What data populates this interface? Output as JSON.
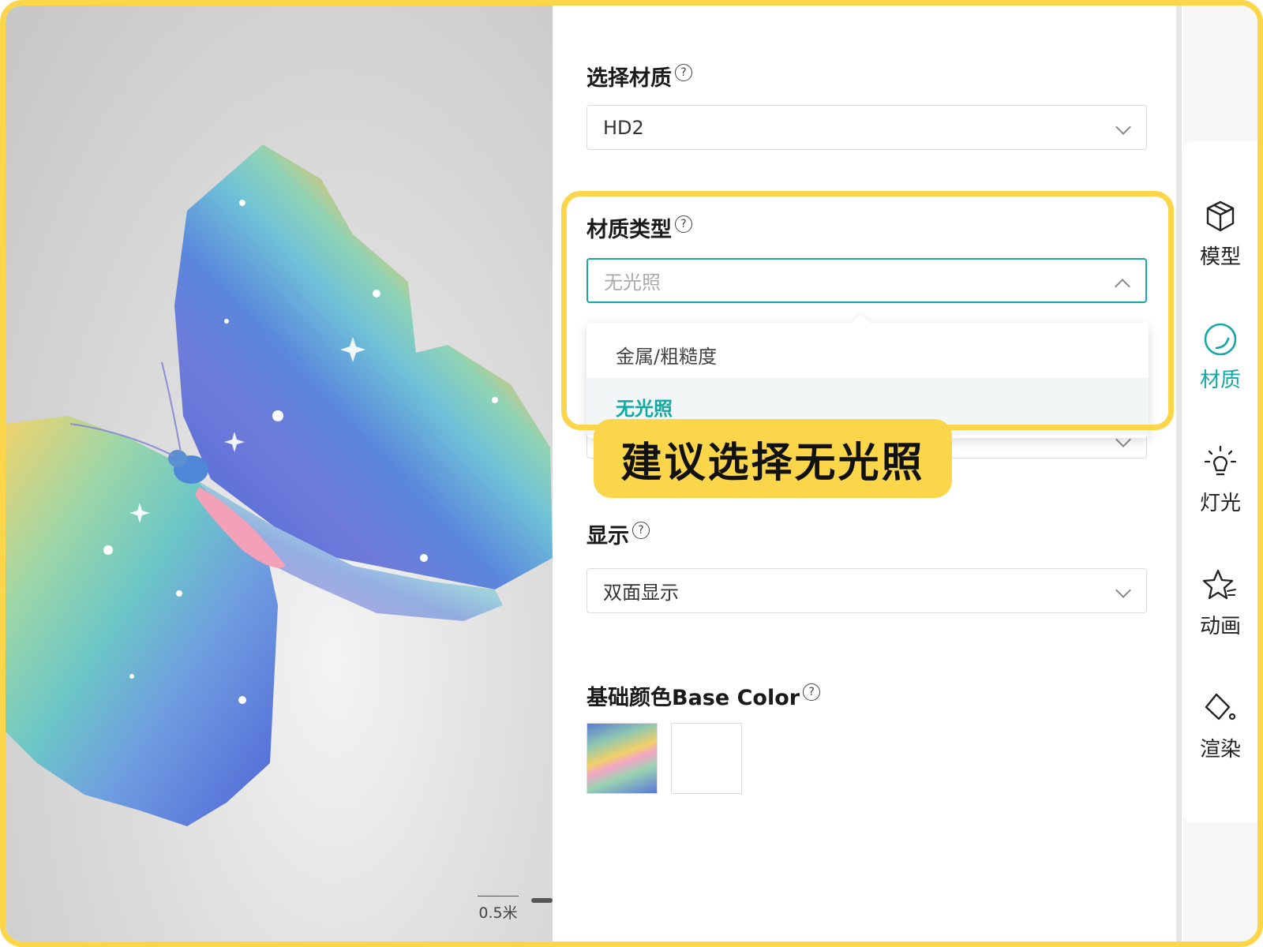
{
  "viewport": {
    "scale_label": "0.5米"
  },
  "panel": {
    "material_select": {
      "label": "选择材质",
      "value": "HD2"
    },
    "material_type": {
      "label": "材质类型",
      "placeholder": "无光照",
      "options": [
        {
          "label": "金属/粗糙度",
          "selected": false
        },
        {
          "label": "无光照",
          "selected": true
        }
      ]
    },
    "display": {
      "label": "显示",
      "value": "双面显示"
    },
    "base_color": {
      "label": "基础颜色Base Color"
    },
    "help_glyph": "?"
  },
  "annotation": {
    "tip": "建议选择无光照"
  },
  "rightbar": {
    "items": [
      {
        "label": "模型",
        "icon": "cube-icon",
        "active": false
      },
      {
        "label": "材质",
        "icon": "material-circle-icon",
        "active": true
      },
      {
        "label": "灯光",
        "icon": "bulb-icon",
        "active": false
      },
      {
        "label": "动画",
        "icon": "star-sparkle-icon",
        "active": false
      },
      {
        "label": "渲染",
        "icon": "paint-bucket-icon",
        "active": false
      }
    ]
  },
  "colors": {
    "accent": "#15a7a2",
    "highlight": "#fbd64a"
  }
}
